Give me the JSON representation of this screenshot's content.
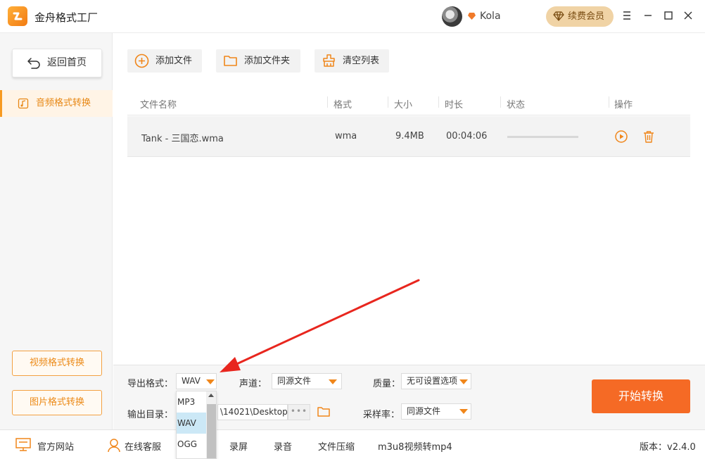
{
  "app": {
    "title": "金舟格式工厂",
    "username": "Kola",
    "renew_label": "续费会员"
  },
  "window_controls": [
    "menu-icon",
    "minimize-icon",
    "maximize-icon",
    "close-icon"
  ],
  "sidebar": {
    "home_label": "返回首页",
    "active_item": "音频格式转换",
    "video_btn": "视频格式转换",
    "image_btn": "图片格式转换"
  },
  "toolbar": {
    "add_file": "添加文件",
    "add_folder": "添加文件夹",
    "clear_list": "清空列表"
  },
  "table": {
    "headers": {
      "name": "文件名称",
      "format": "格式",
      "size": "大小",
      "duration": "时长",
      "status": "状态",
      "action": "操作"
    },
    "rows": [
      {
        "name": "Tank - 三国恋.wma",
        "format": "wma",
        "size": "9.4MB",
        "duration": "00:04:06"
      }
    ]
  },
  "settings": {
    "export_format_label": "导出格式：",
    "export_format_value": "WAV",
    "channel_label": "声道：",
    "channel_value": "同源文件",
    "quality_label": "质量：",
    "quality_value": "无可设置选项",
    "output_dir_label": "输出目录：",
    "output_dir_value": "\\14021\\Desktop\\",
    "sample_rate_label": "采样率：",
    "sample_rate_value": "同源文件",
    "start_label": "开始转换"
  },
  "format_dropdown": {
    "options": [
      "MP3",
      "WAV",
      "OGG"
    ],
    "selected": "WAV"
  },
  "footer": {
    "website": "官方网站",
    "support": "在线客服",
    "links": [
      "录屏",
      "录音",
      "文件压缩",
      "m3u8视频转mp4"
    ],
    "version_label": "版本：",
    "version": "v2.4.0"
  },
  "colors": {
    "accent": "#f56a25",
    "orange": "#f0861a",
    "annotation_arrow": "#e8261e"
  }
}
